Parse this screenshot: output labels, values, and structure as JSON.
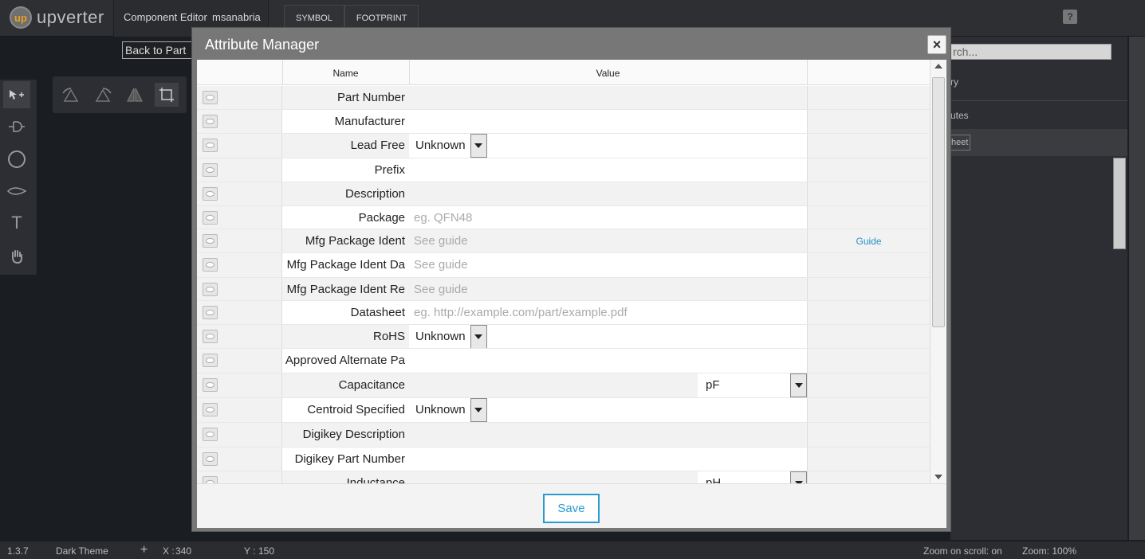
{
  "app": {
    "logo_text": "upverter",
    "logo_mark": "up",
    "editor_title": "Component Editor",
    "username": "msanabria",
    "tabs": [
      {
        "label": "SYMBOL"
      },
      {
        "label": "FOOTPRINT"
      }
    ],
    "help_label": "?",
    "back_button": "Back to Part"
  },
  "right_panel": {
    "search_placeholder": "rch...",
    "item1": "ry",
    "item2": "utes",
    "sheet_btn": "heet"
  },
  "status": {
    "version": "1.3.7",
    "theme": "Dark Theme",
    "x_label": "X :",
    "x_value": "340",
    "y_label": "Y :",
    "y_value": "150",
    "zoom_scroll": "Zoom on scroll: on",
    "zoom_level": "Zoom: 100%"
  },
  "modal": {
    "title": "Attribute Manager",
    "close_label": "×",
    "save_label": "Save",
    "columns": {
      "name": "Name",
      "value": "Value"
    },
    "rows": [
      {
        "name": "Part Number",
        "value": ""
      },
      {
        "name": "Manufacturer",
        "value": ""
      },
      {
        "name": "Lead Free",
        "select": "Unknown"
      },
      {
        "name": "Prefix",
        "value": ""
      },
      {
        "name": "Description",
        "value": ""
      },
      {
        "name": "Package",
        "placeholder": "eg. QFN48"
      },
      {
        "name": "Mfg Package Ident",
        "placeholder": "See guide",
        "action": "Guide"
      },
      {
        "name": "Mfg Package Ident Da",
        "placeholder": "See guide"
      },
      {
        "name": "Mfg Package Ident Re",
        "placeholder": "See guide"
      },
      {
        "name": "Datasheet",
        "placeholder": "eg. http://example.com/part/example.pdf"
      },
      {
        "name": "RoHS",
        "select": "Unknown"
      },
      {
        "name": "Approved Alternate Pa",
        "value": ""
      },
      {
        "name": "Capacitance",
        "unit": "pF"
      },
      {
        "name": "Centroid Specified",
        "select": "Unknown"
      },
      {
        "name": "Digikey Description",
        "value": ""
      },
      {
        "name": "Digikey Part Number",
        "value": ""
      },
      {
        "name": "Inductance",
        "unit": "pH"
      }
    ]
  }
}
